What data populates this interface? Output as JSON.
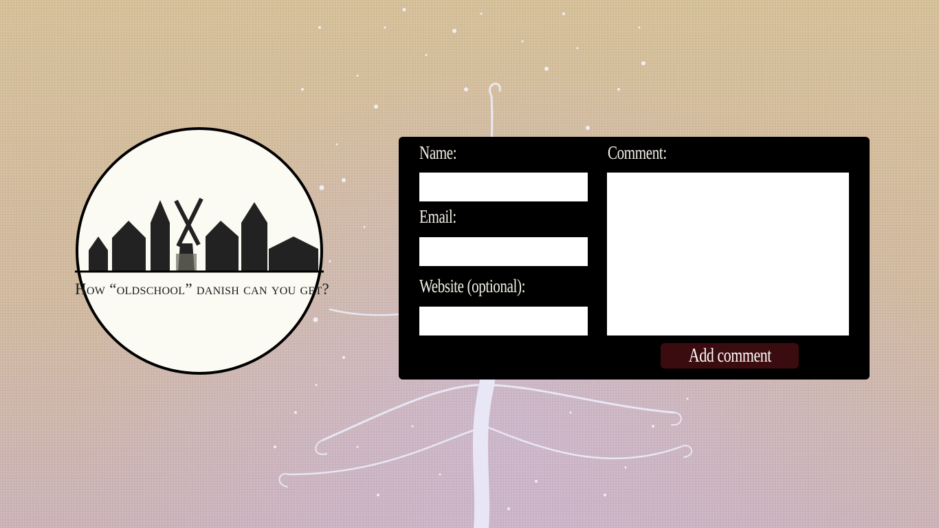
{
  "logo": {
    "caption": "How “oldschool” danish can you get?"
  },
  "comment_form": {
    "name_label": "Name:",
    "email_label": "Email:",
    "website_label": "Website (optional):",
    "comment_label": "Comment:",
    "name_value": "",
    "email_value": "",
    "website_value": "",
    "comment_value": "",
    "submit_label": "Add comment"
  },
  "colors": {
    "background": "#d2bb98",
    "panel": "#000000",
    "button": "#3b0c0f",
    "field": "#ffffff"
  },
  "background_art": {
    "description_icon": "snowflake-tree-illustration"
  }
}
